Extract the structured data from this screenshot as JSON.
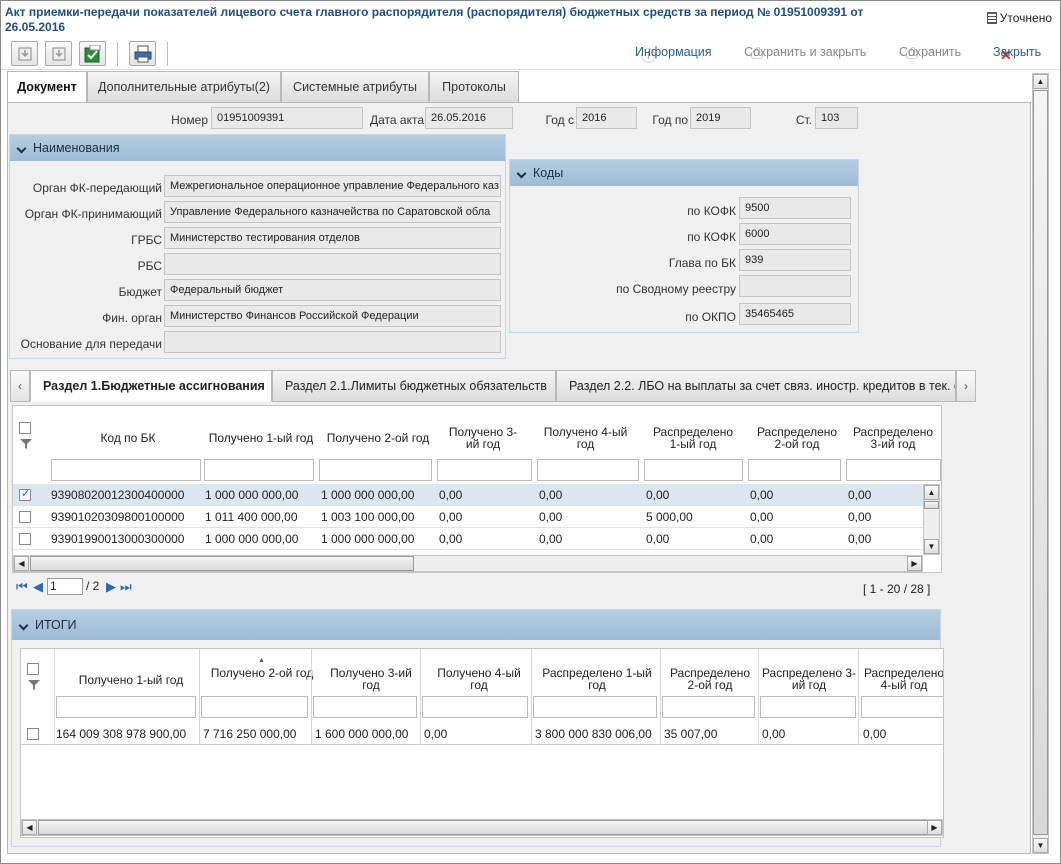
{
  "window": {
    "title": "Акт приемки-передачи показателей лицевого счета главного распорядителя (распорядителя) бюджетных средств за период № 01951009391 от 26.05.2016",
    "status_label": "Уточнено"
  },
  "toolbar": {
    "info_label": "Информация",
    "save_close_label": "Сохранить и закрыть",
    "save_label": "Сохранить",
    "close_label": "Закрыть"
  },
  "tabs": [
    {
      "label": "Документ"
    },
    {
      "label": "Дополнительные атрибуты(2)"
    },
    {
      "label": "Системные атрибуты"
    },
    {
      "label": "Протоколы"
    }
  ],
  "header_fields": {
    "number_label": "Номер",
    "number_value": "01951009391",
    "date_label": "Дата акта",
    "date_value": "26.05.2016",
    "year_from_label": "Год с",
    "year_from_value": "2016",
    "year_to_label": "Год по",
    "year_to_value": "2019",
    "article_label": "Ст.",
    "article_value": "103"
  },
  "names_panel": {
    "title": "Наименования",
    "fields": [
      {
        "label": "Орган ФК-передающий",
        "value": "Межрегиональное операционное управление Федерального каз"
      },
      {
        "label": "Орган ФК-принимающий",
        "value": "Управление Федерального казначейства по Саратовской обла"
      },
      {
        "label": "ГРБС",
        "value": "Министерство тестирования отделов"
      },
      {
        "label": "РБС",
        "value": ""
      },
      {
        "label": "Бюджет",
        "value": "Федеральный бюджет"
      },
      {
        "label": "Фин. орган",
        "value": "Министерство Финансов Российской Федерации"
      },
      {
        "label": "Основание для передачи",
        "value": ""
      }
    ]
  },
  "codes_panel": {
    "title": "Коды",
    "fields": [
      {
        "label": "по КОФК",
        "value": "9500"
      },
      {
        "label": "по КОФК",
        "value": "6000"
      },
      {
        "label": "Глава по БК",
        "value": "939"
      },
      {
        "label": "по Сводному реестру",
        "value": ""
      },
      {
        "label": "по ОКПО",
        "value": "35465465"
      }
    ]
  },
  "section_tabs": [
    {
      "label": "Раздел 1.Бюджетные ассигнования"
    },
    {
      "label": "Раздел 2.1.Лимиты бюджетных обязательств"
    },
    {
      "label": "Раздел 2.2. ЛБО на выплаты за счет связ. иностр. кредитов в тек. фи"
    }
  ],
  "main_grid": {
    "columns": [
      "Код по БК",
      "Получено 1-ый год",
      "Получено 2-ой год",
      "Получено 3-ий год",
      "Получено 4-ый год",
      "Распределено 1-ый год",
      "Распределено 2-ой год",
      "Распределено 3-ий год"
    ],
    "rows": [
      {
        "checked": true,
        "cells": [
          "93908020012300400000",
          "1 000 000 000,00",
          "1 000 000 000,00",
          "0,00",
          "0,00",
          "0,00",
          "0,00",
          "0,00"
        ]
      },
      {
        "checked": false,
        "cells": [
          "93901020309800100000",
          "1 011 400 000,00",
          "1 003 100 000,00",
          "0,00",
          "0,00",
          "5 000,00",
          "0,00",
          "0,00"
        ]
      },
      {
        "checked": false,
        "cells": [
          "93901990013000300000",
          "1 000 000 000,00",
          "1 000 000 000,00",
          "0,00",
          "0,00",
          "0,00",
          "0,00",
          "0,00"
        ]
      }
    ],
    "pager": {
      "current_page": "1",
      "total_pages": "/ 2",
      "range": "[ 1 - 20 / 28 ]"
    }
  },
  "totals_panel": {
    "title": "ИТОГИ",
    "columns": [
      "Получено 1-ый год",
      "Получено 2-ой год",
      "Получено 3-ий год",
      "Получено 4-ый год",
      "Распределено 1-ый год",
      "Распределено 2-ой год",
      "Распределено 3-ий год",
      "Распределено 4-ый год"
    ],
    "row": [
      "164 009 308 978 900,00",
      "7 716 250 000,00",
      "1 600 000 000,00",
      "0,00",
      "3 800 000 830 006,00",
      "35 007,00",
      "0,00",
      "0,00"
    ]
  },
  "colors": {
    "accent": "#1f4e86",
    "panel_header": "#a8c4dc",
    "selected_row": "#dbe6f1"
  }
}
